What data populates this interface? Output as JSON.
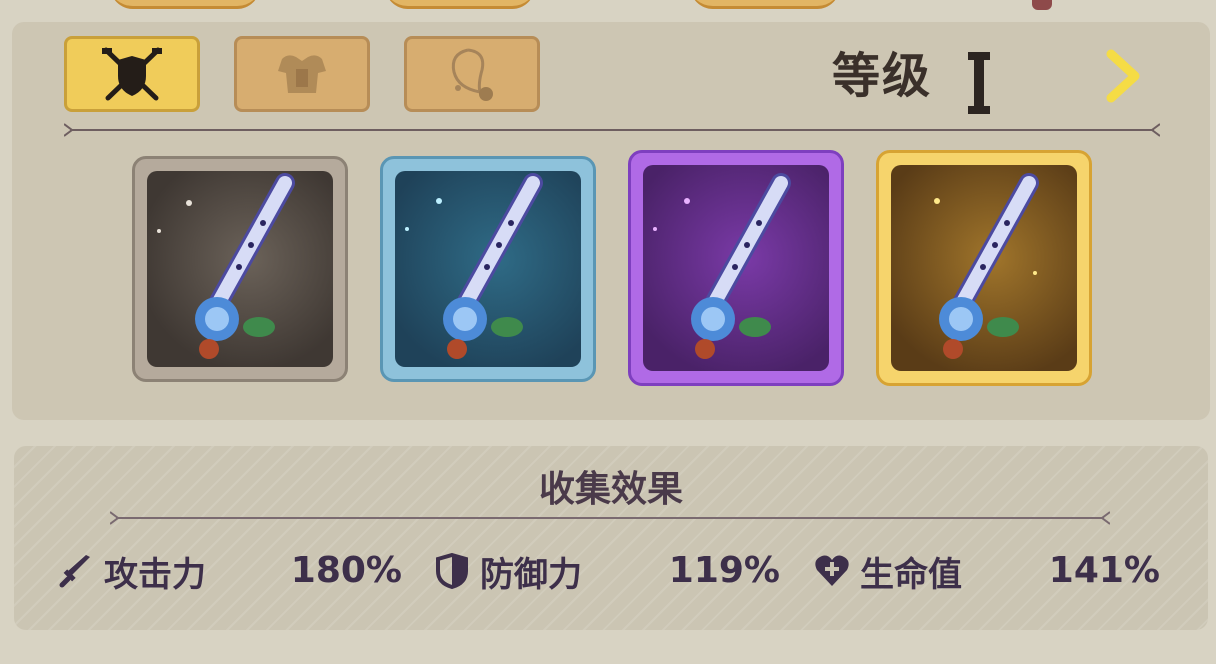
{
  "header": {
    "tabs": [
      {
        "icon": "crossed-swords-shield-icon",
        "active": true
      },
      {
        "icon": "armor-icon",
        "active": false
      },
      {
        "icon": "necklace-icon",
        "active": false
      }
    ],
    "level_label": "等级",
    "level_value": "I",
    "next_icon": "chevron-right-icon"
  },
  "cards": [
    {
      "rarity": "common",
      "frame_color": "#b5aa9c",
      "item_icon": "flute-icon"
    },
    {
      "rarity": "rare",
      "frame_color": "#8ec2db",
      "item_icon": "flute-icon"
    },
    {
      "rarity": "epic",
      "frame_color": "#b06ae6",
      "item_icon": "flute-icon"
    },
    {
      "rarity": "legendary",
      "frame_color": "#f6d46c",
      "item_icon": "flute-icon"
    }
  ],
  "collection_effects": {
    "title": "收集效果",
    "stats": [
      {
        "icon": "sword-icon",
        "name": "攻击力",
        "value": "180%"
      },
      {
        "icon": "shield-icon",
        "name": "防御力",
        "value": "119%"
      },
      {
        "icon": "heart-icon",
        "name": "生命值",
        "value": "141%"
      }
    ]
  },
  "colors": {
    "background": "#d8d3c3",
    "active_tab": "#f0cc5a",
    "inactive_tab": "#d7ad70",
    "text_dark": "#3d2f4a",
    "accent_chevron": "#f5dc45"
  }
}
